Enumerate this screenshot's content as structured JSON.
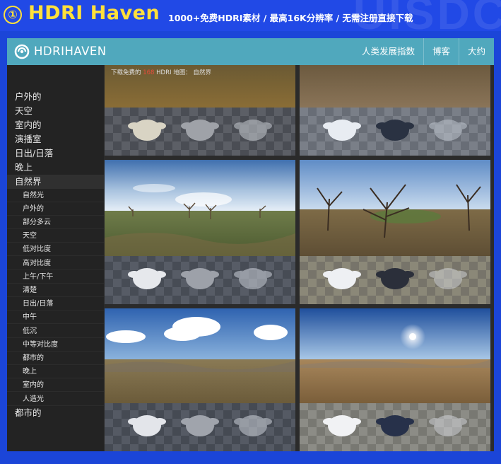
{
  "banner": {
    "number": "①",
    "title": "HDRI Haven",
    "subtitle": "1000+免费HDRI素材 / 最高16K分辨率 / 无需注册直接下载",
    "deco_text": "UISDC"
  },
  "navbar": {
    "brand": "HDRIHAVEN",
    "links": [
      "人类发展指数",
      "博客",
      "大约"
    ]
  },
  "sidebar": {
    "categories": [
      "户外的",
      "天空",
      "室内的",
      "演播室",
      "日出/日落",
      "晚上",
      "自然界"
    ],
    "active": "自然界",
    "subcategories": [
      "自然光",
      "户外的",
      "部分多云",
      "天空",
      "低对比度",
      "高对比度",
      "上午/下午",
      "清楚",
      "日出/日落",
      "中午",
      "低沉",
      "中等对比度",
      "都市的",
      "晚上",
      "室内的",
      "人造光"
    ],
    "last": "都市的"
  },
  "breadcrumb": {
    "prefix": "下载免费的",
    "highlight": "168",
    "suffix": "HDRI 地图： 自然界"
  },
  "colors": {
    "banner_bg": "#2149e6",
    "banner_title": "#ffe03b",
    "navbar_bg": "#50a8bd",
    "sidebar_bg": "#232323",
    "content_bg": "#2b2b2b"
  }
}
